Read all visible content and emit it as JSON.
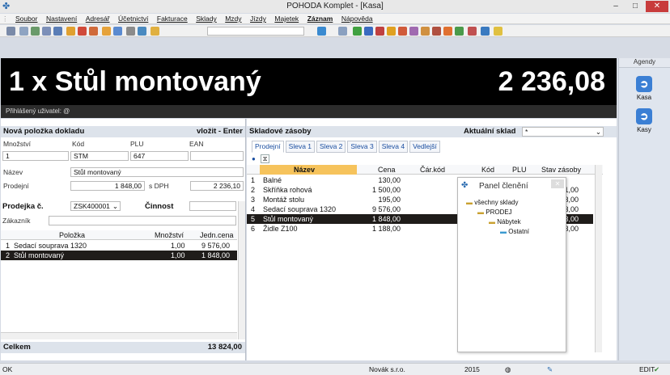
{
  "window": {
    "title": "POHODA Komplet - [Kasa]"
  },
  "menu": [
    "Soubor",
    "Nastavení",
    "Adresář",
    "Účetnictví",
    "Fakturace",
    "Sklady",
    "Mzdy",
    "Jízdy",
    "Majetek",
    "Záznam",
    "Nápověda"
  ],
  "display": {
    "product": "1 x  Stůl montovaný",
    "amount": "2 236,08",
    "user": "Přihlášený uživatel: @"
  },
  "agendy": {
    "title": "Agendy",
    "items": [
      "Kasa",
      "Kasy"
    ]
  },
  "new_item": {
    "title": "Nová položka dokladu",
    "action": "vložit - Enter",
    "col_mnozstvi": "Množství",
    "col_kod": "Kód",
    "col_plu": "PLU",
    "col_ean": "EAN",
    "mnozstvi": "1",
    "kod": "STM",
    "plu": "647",
    "ean": "",
    "label_nazev": "Název",
    "nazev": "Stůl montovaný",
    "label_prodejni": "Prodejní",
    "prodejni": "1 848,00",
    "sdph_label": "s DPH",
    "sdph": "2 236,10"
  },
  "prodejka": {
    "label": "Prodejka č.",
    "number": "ZSK400001",
    "cinnost_label": "Činnost",
    "cinnost": "",
    "zakaznik_label": "Zákazník",
    "zakaznik": "",
    "headers": [
      "Položka",
      "Množství",
      "Jedn.cena"
    ],
    "rows": [
      {
        "n": "1",
        "name": "Sedací souprava 1320",
        "qty": "1,00",
        "price": "9 576,00"
      },
      {
        "n": "2",
        "name": "Stůl montovaný",
        "qty": "1,00",
        "price": "1 848,00"
      }
    ],
    "total_label": "Celkem",
    "total": "13 824,00"
  },
  "stock": {
    "title": "Skladové zásoby",
    "warehouse_label": "Aktuální sklad",
    "warehouse": "*",
    "tabs": [
      "Prodejní",
      "Sleva 1",
      "Sleva 2",
      "Sleva 3",
      "Sleva 4",
      "Vedlejší"
    ],
    "headers": [
      "Název",
      "Cena",
      "Čár.kód",
      "Kód",
      "PLU",
      "Stav zásoby"
    ],
    "rows": [
      {
        "n": "1",
        "name": "Balné",
        "price": "130,00",
        "stav": ""
      },
      {
        "n": "2",
        "name": "Skříňka rohová",
        "price": "1 500,00",
        "stav": "1,00"
      },
      {
        "n": "3",
        "name": "Montáž stolu",
        "price": "195,00",
        "stav": "3,00"
      },
      {
        "n": "4",
        "name": "Sedací souprava 1320",
        "price": "9 576,00",
        "stav": "3,00"
      },
      {
        "n": "5",
        "name": "Stůl montovaný",
        "price": "1 848,00",
        "stav": "3,00"
      },
      {
        "n": "6",
        "name": "Židle Z100",
        "price": "1 188,00",
        "stav": "3,00"
      }
    ]
  },
  "panel": {
    "title": "Panel členění",
    "tree": [
      "všechny sklady",
      "PRODEJ",
      "Nábytek",
      "Ostatní"
    ]
  },
  "status": {
    "left": "OK",
    "company": "Novák s.r.o.",
    "year": "2015",
    "mode": "EDIT"
  }
}
